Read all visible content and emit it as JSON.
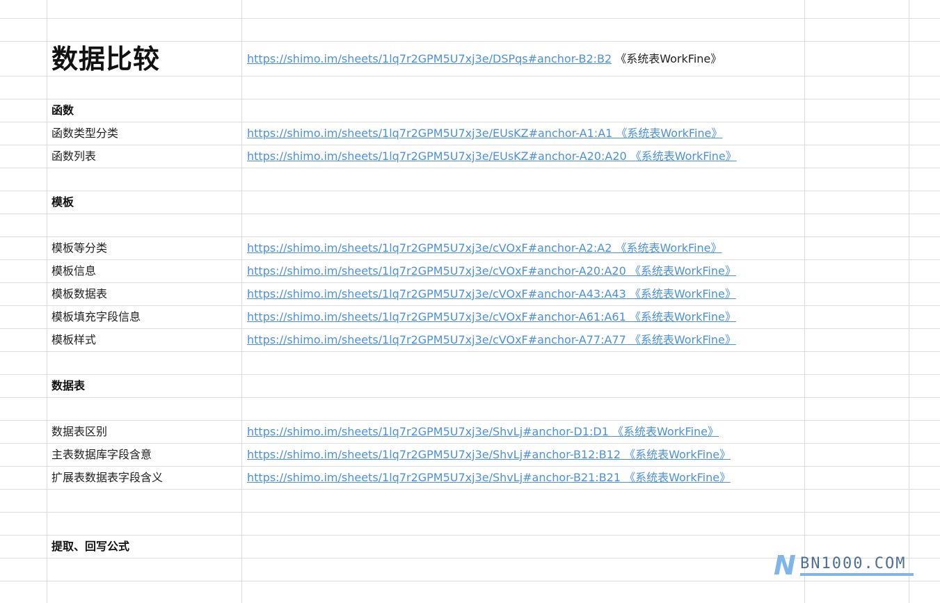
{
  "sheet": {
    "title": "数据比较",
    "title_link": "https://shimo.im/sheets/1lq7r2GPM5U7xj3e/DSPqs#anchor-B2:B2",
    "title_link_suffix": " 《系统表WorkFine》",
    "sections": {
      "functions": {
        "heading": "函数",
        "rows": [
          {
            "label": "函数类型分类",
            "link": "https://shimo.im/sheets/1lq7r2GPM5U7xj3e/EUsKZ#anchor-A1:A1 《系统表WorkFine》 "
          },
          {
            "label": "函数列表",
            "link": "https://shimo.im/sheets/1lq7r2GPM5U7xj3e/EUsKZ#anchor-A20:A20 《系统表WorkFine》 "
          }
        ]
      },
      "templates": {
        "heading": "模板",
        "rows": [
          {
            "label": "模板等分类",
            "link": "https://shimo.im/sheets/1lq7r2GPM5U7xj3e/cVOxF#anchor-A2:A2 《系统表WorkFine》 "
          },
          {
            "label": "模板信息",
            "link": "https://shimo.im/sheets/1lq7r2GPM5U7xj3e/cVOxF#anchor-A20:A20 《系统表WorkFine》 "
          },
          {
            "label": "模板数据表",
            "link": "https://shimo.im/sheets/1lq7r2GPM5U7xj3e/cVOxF#anchor-A43:A43 《系统表WorkFine》 "
          },
          {
            "label": "模板填充字段信息",
            "link": "https://shimo.im/sheets/1lq7r2GPM5U7xj3e/cVOxF#anchor-A61:A61 《系统表WorkFine》 "
          },
          {
            "label": "模板样式",
            "link": "https://shimo.im/sheets/1lq7r2GPM5U7xj3e/cVOxF#anchor-A77:A77 《系统表WorkFine》 "
          }
        ]
      },
      "datatables": {
        "heading": "数据表",
        "rows": [
          {
            "label": "数据表区别",
            "link": "https://shimo.im/sheets/1lq7r2GPM5U7xj3e/ShvLj#anchor-D1:D1 《系统表WorkFine》 "
          },
          {
            "label": "主表数据库字段含意",
            "link": "https://shimo.im/sheets/1lq7r2GPM5U7xj3e/ShvLj#anchor-B12:B12 《系统表WorkFine》 "
          },
          {
            "label": "扩展表数据表字段含义",
            "link": "https://shimo.im/sheets/1lq7r2GPM5U7xj3e/ShvLj#anchor-B21:B21 《系统表WorkFine》 "
          }
        ]
      },
      "formulas": {
        "heading": "提取、回写公式"
      }
    }
  },
  "watermark": {
    "mark": "N",
    "text": "BN1000.COM"
  },
  "colors": {
    "link": "#4a90e2",
    "gridline": "#dcdde0",
    "watermark": "#7fb6ea"
  }
}
